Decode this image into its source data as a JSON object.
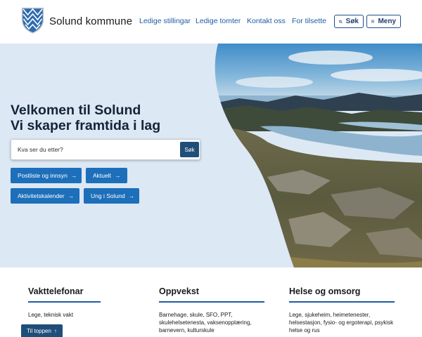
{
  "header": {
    "brand": "Solund kommune",
    "nav": [
      {
        "label": "Ledige stillingar"
      },
      {
        "label": "Ledige tomter"
      },
      {
        "label": "Kontakt oss"
      },
      {
        "label": "For tilsette"
      }
    ],
    "search_label": "Søk",
    "menu_label": "Meny",
    "colors": {
      "accent": "#1f5aa6",
      "dark": "#1f4e79",
      "button": "#1d6fba"
    }
  },
  "hero": {
    "title_line1": "Velkomen til Solund",
    "title_line2": "Vi skaper framtida i lag",
    "search": {
      "placeholder": "Kva ser du etter?",
      "button": "Søk"
    },
    "quick_links": [
      {
        "label": "Postliste og innsyn"
      },
      {
        "label": "Aktuelt"
      },
      {
        "label": "Aktivitetskalender"
      },
      {
        "label": "Ung i Solund"
      }
    ]
  },
  "sections": [
    {
      "title": "Vakttelefonar",
      "text": "Lege, teknisk vakt"
    },
    {
      "title": "Oppvekst",
      "text": "Barnehage, skule, SFO, PPT, skulehelsetenesta, vaksenopplæring, barnevern, kulturskule"
    },
    {
      "title": "Helse og omsorg",
      "text": "Lege, sjukeheim, heimetenester, helsestasjon, fysio- og ergoterapi, psykisk helse og rus"
    }
  ],
  "to_top": "Til toppen"
}
